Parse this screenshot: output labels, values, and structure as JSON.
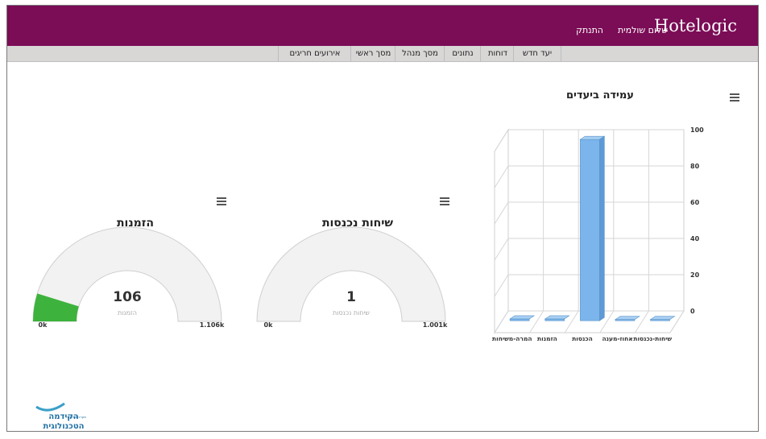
{
  "header": {
    "brand": "Hotelogic",
    "greeting": "שלום שולמית",
    "logout": "התנתק"
  },
  "nav": {
    "items": [
      "יעד חדש",
      "דוחות",
      "נתונים",
      "מסך מנהל",
      "מסך ראשי",
      "אירועים חריגים"
    ]
  },
  "goals_chart": {
    "title": "עמידה ביעדים",
    "menu_icon": "hamburger-icon"
  },
  "gauge_leads": {
    "title": "שיחות נכנסות",
    "value": "1",
    "unit_label": "שיחות נכנסות",
    "min_label": "0k",
    "max_label": "1.001k",
    "fill_fraction": 0.001,
    "menu_icon": "hamburger-icon"
  },
  "gauge_orders": {
    "title": "הזמנות",
    "value": "106",
    "unit_label": "הזמנות",
    "min_label": "0k",
    "max_label": "1.106k",
    "fill_fraction": 0.0958,
    "fill_color": "#3db33d",
    "menu_icon": "hamburger-icon"
  },
  "chart_data": {
    "type": "bar",
    "title": "עמידה ביעדים",
    "categories": [
      "שיחות-נכנסות",
      "אחוז-מענה",
      "הכנסות",
      "הזמנות",
      "המרה-משיחות"
    ],
    "values": [
      0.5,
      0,
      100,
      1,
      1
    ],
    "ylim": [
      0,
      100
    ],
    "yticks": [
      "0",
      "20",
      "40",
      "60",
      "80",
      "100"
    ],
    "grid": true,
    "bar_color": "#7cb5ec"
  },
  "footer": {
    "logo_main": "הקידמה",
    "logo_sub": "הטכנולוגית",
    "logo_small": "מערכות לניהול"
  }
}
